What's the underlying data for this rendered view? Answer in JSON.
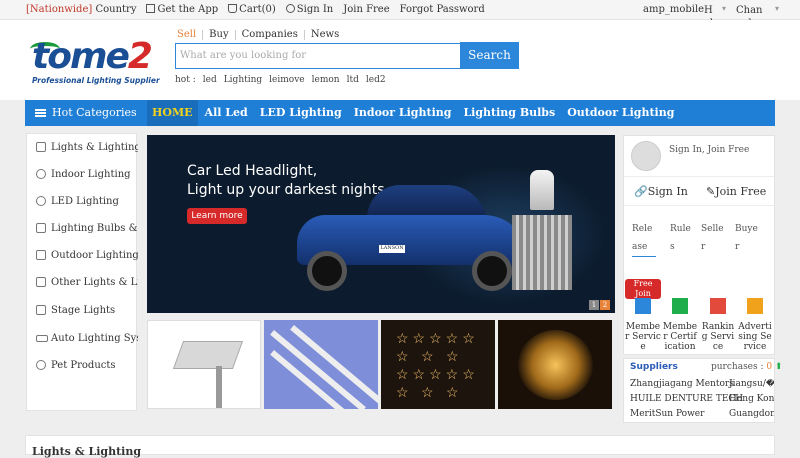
{
  "topbar": {
    "nationwide": "[Nationwide]",
    "country": "Country",
    "get_app": "Get the App",
    "cart_label": "Cart",
    "cart_count": "(0)",
    "sign_in": "Sign In",
    "join_free": "Join Free",
    "forgot": "Forgot Password",
    "user": "amp_mobile",
    "help": "Help",
    "channel": "Channel"
  },
  "logo": {
    "main": "tome",
    "accent": "2",
    "tagline": "Professional Lighting Supplier"
  },
  "search": {
    "tabs": [
      "Sell",
      "Buy",
      "Companies",
      "News"
    ],
    "placeholder": "What are you looking for",
    "button": "Search",
    "hot_label": "hot :",
    "hot_terms": [
      "led",
      "Lighting",
      "leimove",
      "lemon",
      "ltd",
      "led2"
    ]
  },
  "nav": {
    "hot_categories": "Hot Categories",
    "items": [
      "HOME",
      "All Led",
      "LED Lighting",
      "Indoor Lighting",
      "Lighting Bulbs",
      "Outdoor Lighting"
    ]
  },
  "sidebar": {
    "items": [
      {
        "label": "Lights & Lighting",
        "icon": "lightbulb-icon"
      },
      {
        "label": "Indoor Lighting",
        "icon": "ceiling-lamp-icon"
      },
      {
        "label": "LED Lighting",
        "icon": "led-icon"
      },
      {
        "label": "Lighting Bulbs & Tubes",
        "icon": "bulb-icon"
      },
      {
        "label": "Outdoor Lighting",
        "icon": "street-lamp-icon"
      },
      {
        "label": "Other Lights & Lighting",
        "icon": "lamp-icon"
      },
      {
        "label": "Stage Lights",
        "icon": "stage-light-icon"
      },
      {
        "label": "Auto Lighting System",
        "icon": "car-icon"
      },
      {
        "label": "Pet Products",
        "icon": "paw-icon"
      }
    ]
  },
  "banner": {
    "title1": "Car Led Headlight,",
    "title2": "Light up your darkest nights",
    "cta": "Learn more",
    "plate": "LANSON",
    "pages": [
      "1",
      "2"
    ]
  },
  "account": {
    "sign_top": "Sign In, Join Free",
    "sign_in": "Sign In",
    "join_free": "Join Free",
    "tabs": [
      "Release",
      "Rules",
      "Seller",
      "Buyer"
    ],
    "free_join": "Free Join",
    "services": [
      {
        "label": "Member Service",
        "icon": "member-service-icon",
        "color": "#2c86d9"
      },
      {
        "label": "Member Certification",
        "icon": "certification-icon",
        "color": "#1fae4b"
      },
      {
        "label": "Ranking Service",
        "icon": "ranking-icon",
        "color": "#e24a3b"
      },
      {
        "label": "Advertising Service",
        "icon": "advertising-icon",
        "color": "#f0a21c"
      }
    ]
  },
  "suppliers": {
    "heading": "Suppliers",
    "purchases": "purchases",
    "purchases_count": "0",
    "rows": [
      {
        "name": "Zhangjiagang Mentors",
        "location": "Jiangsu/�"
      },
      {
        "name": "HUILE DENTURE TECH",
        "location": "Hong Kong"
      },
      {
        "name": "MeritSun Power",
        "location": "Guangdong/"
      }
    ]
  },
  "bottom": {
    "title": "Lights & Lighting"
  },
  "colors": {
    "brand_blue": "#1f7fd6",
    "accent_orange": "#e8833a",
    "red": "#d62a2a"
  }
}
